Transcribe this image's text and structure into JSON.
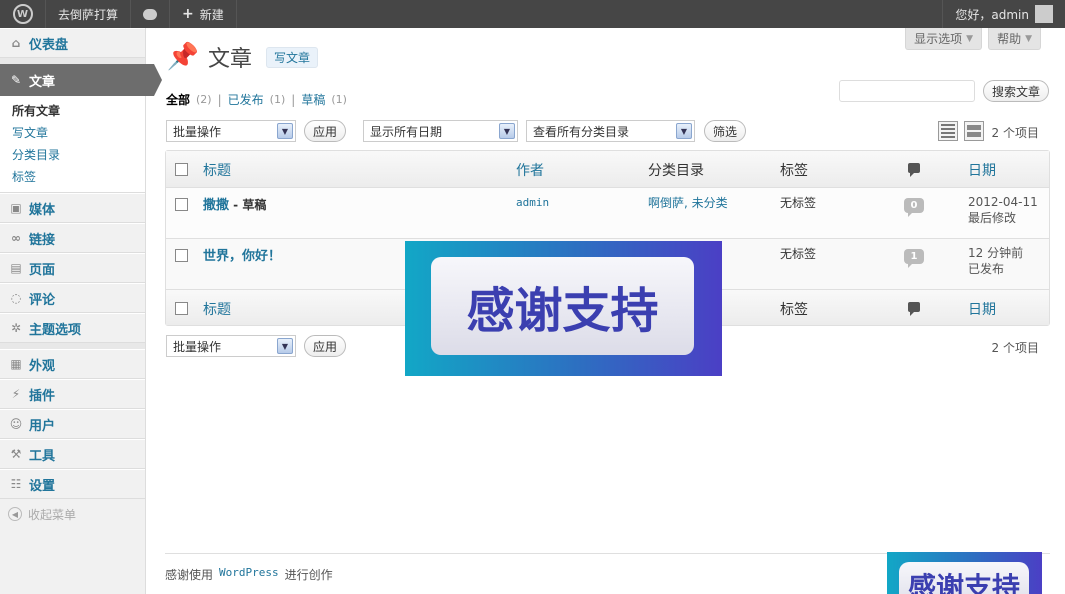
{
  "adminbar": {
    "site_name": "去倒萨打算",
    "new_label": "新建",
    "greeting": "您好，admin"
  },
  "sidebar": {
    "items": [
      {
        "label": "仪表盘"
      },
      {
        "label": "文章"
      },
      {
        "label": "媒体"
      },
      {
        "label": "链接"
      },
      {
        "label": "页面"
      },
      {
        "label": "评论"
      },
      {
        "label": "主题选项"
      },
      {
        "label": "外观"
      },
      {
        "label": "插件"
      },
      {
        "label": "用户"
      },
      {
        "label": "工具"
      },
      {
        "label": "设置"
      }
    ],
    "submenu": [
      "所有文章",
      "写文章",
      "分类目录",
      "标签"
    ],
    "collapse_label": "收起菜单"
  },
  "screen_tabs": {
    "options": "显示选项",
    "help": "帮助"
  },
  "page": {
    "title": "文章",
    "add_new": "写文章",
    "search_button": "搜索文章",
    "search_placeholder": ""
  },
  "filters": {
    "all": "全部",
    "all_count": "(2)",
    "published": "已发布",
    "published_count": "(1)",
    "draft": "草稿",
    "draft_count": "(1)"
  },
  "toolbar": {
    "bulk_action": "批量操作",
    "apply": "应用",
    "date_filter": "显示所有日期",
    "category_filter": "查看所有分类目录",
    "filter_button": "筛选",
    "item_count": "2 个项目"
  },
  "table": {
    "headers": {
      "title": "标题",
      "author": "作者",
      "categories": "分类目录",
      "tags": "标签",
      "date": "日期"
    },
    "rows": [
      {
        "title": "撒撒",
        "state": "- 草稿",
        "author": "admin",
        "categories": "啊倒萨, 未分类",
        "tags": "无标签",
        "comments": "0",
        "date": "2012-04-11",
        "date_status": "最后修改"
      },
      {
        "title": "世界，你好！",
        "state": "",
        "author": "",
        "categories": "",
        "tags": "无标签",
        "comments": "1",
        "date": "12 分钟前",
        "date_status": "已发布"
      }
    ]
  },
  "overlay": {
    "text": "感谢支持"
  },
  "footer": {
    "prefix": "感谢使用",
    "wordpress": "WordPress",
    "suffix": "进行创作"
  },
  "colors": {
    "link": "#21759b",
    "adminbar": "#464646",
    "active_menu": "#6d6d6d"
  }
}
